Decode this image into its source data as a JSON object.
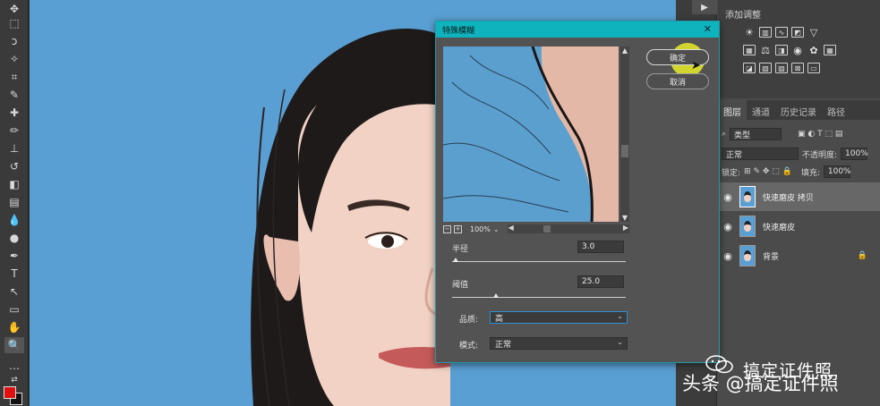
{
  "dialog": {
    "title": "特殊模糊",
    "close": "✕",
    "ok_label": "确定",
    "cancel_label": "取消",
    "zoom": "100%",
    "radius_label": "半径",
    "radius_value": "3.0",
    "radius_level": 0.02,
    "threshold_label": "阈值",
    "threshold_value": "25.0",
    "threshold_level": 0.25,
    "quality_label": "品质:",
    "quality_value": "高",
    "mode_label": "模式:",
    "mode_value": "正常"
  },
  "adjustments": {
    "title": "添加调整"
  },
  "layers_panel": {
    "tabs": [
      "图层",
      "通道",
      "历史记录",
      "路径"
    ],
    "filter_value": "类型",
    "blend_mode": "正常",
    "opacity_label": "不透明度:",
    "opacity_value": "100%",
    "lock_label": "锁定:",
    "fill_label": "填充:",
    "fill_value": "100%",
    "layers": [
      {
        "name": "快速磨皮 拷贝",
        "selected": true
      },
      {
        "name": "快速磨皮",
        "selected": false
      },
      {
        "name": "背景",
        "selected": false,
        "locked": true
      }
    ]
  },
  "watermark": {
    "top": "搞定证件照",
    "bottom": "头条 @搞定证件照"
  },
  "colors": {
    "foreground": "#e01010",
    "background": "#111111",
    "canvas_bg": "#5a9fd3",
    "dialog_title_bar": "#0fb3bd",
    "highlight": "#e8ec28"
  },
  "icons": {
    "play": "▶",
    "eye": "👁",
    "lock": "🔒"
  }
}
